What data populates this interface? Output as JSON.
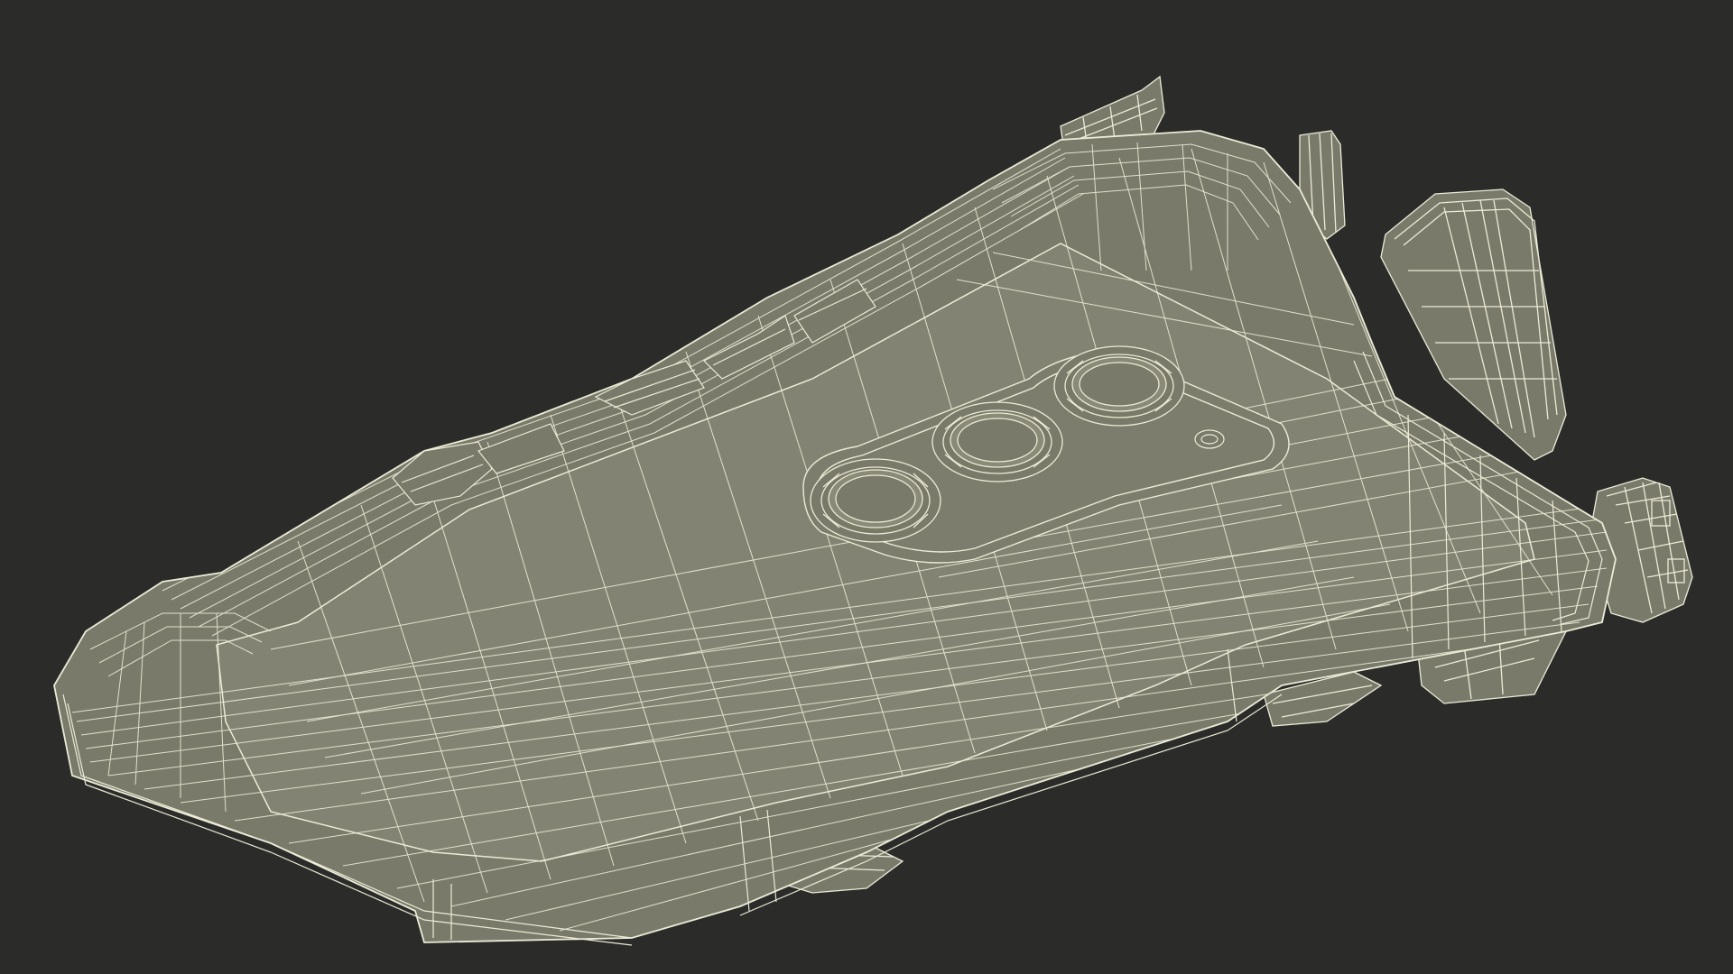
{
  "scene": {
    "subject": "wireframe-phone-case-model",
    "background_color": "#2b2b2a",
    "surface_color": "#7a7a6b",
    "surface_light_color": "#858574",
    "wire_color": "#ecebd6",
    "camera_lens_count": 3
  }
}
